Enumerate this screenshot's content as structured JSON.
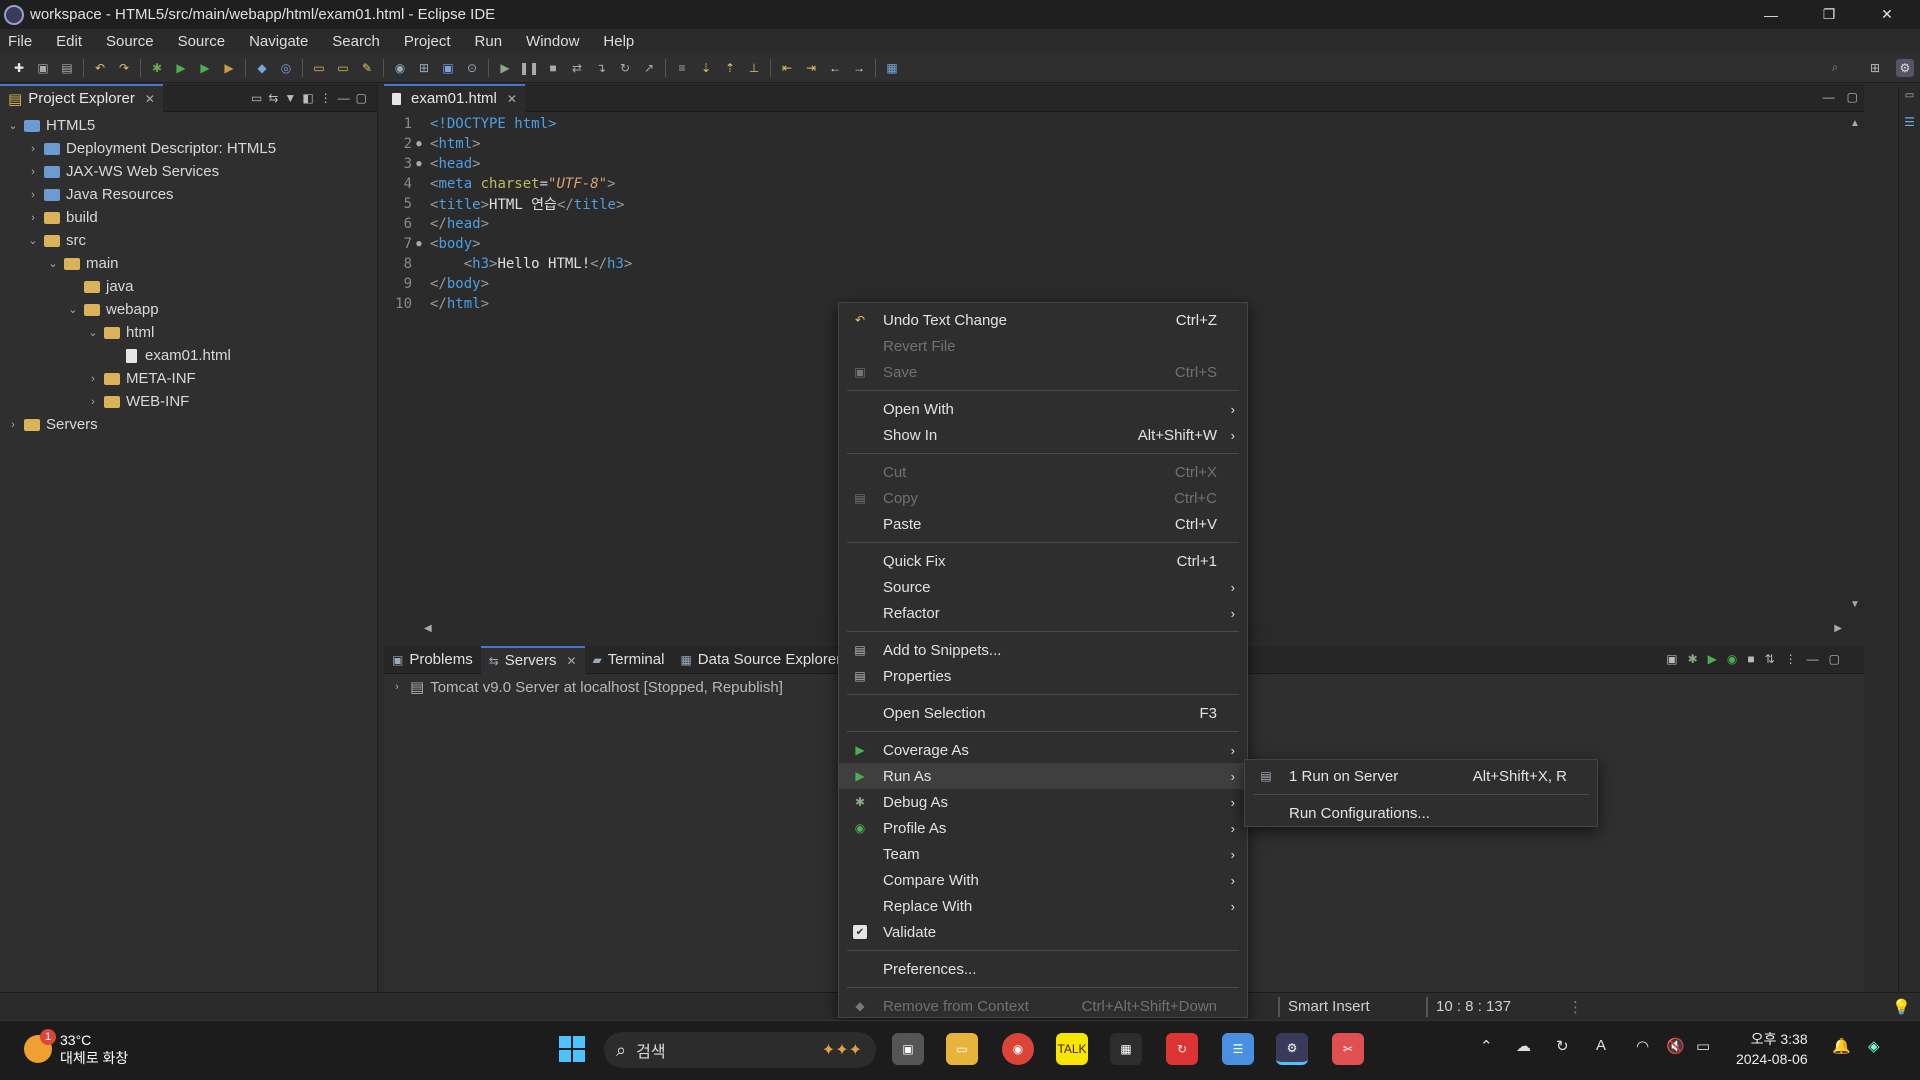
{
  "window": {
    "title": "workspace - HTML5/src/main/webapp/html/exam01.html - Eclipse IDE",
    "minimize": "—",
    "restore": "❐",
    "close": "✕"
  },
  "menubar": [
    "File",
    "Edit",
    "Source",
    "Source",
    "Navigate",
    "Search",
    "Project",
    "Run",
    "Window",
    "Help"
  ],
  "project_explorer": {
    "tab_label": "Project Explorer",
    "tree": [
      {
        "label": "HTML5",
        "depth": 0,
        "chev": "expanded",
        "icon": "proj"
      },
      {
        "label": "Deployment Descriptor: HTML5",
        "depth": 1,
        "chev": "collapsed",
        "icon": "proj"
      },
      {
        "label": "JAX-WS Web Services",
        "depth": 1,
        "chev": "collapsed",
        "icon": "proj"
      },
      {
        "label": "Java Resources",
        "depth": 1,
        "chev": "collapsed",
        "icon": "proj"
      },
      {
        "label": "build",
        "depth": 1,
        "chev": "collapsed",
        "icon": "folder"
      },
      {
        "label": "src",
        "depth": 1,
        "chev": "expanded",
        "icon": "folder"
      },
      {
        "label": "main",
        "depth": 2,
        "chev": "expanded",
        "icon": "folder"
      },
      {
        "label": "java",
        "depth": 3,
        "chev": "none",
        "icon": "folder"
      },
      {
        "label": "webapp",
        "depth": 3,
        "chev": "expanded",
        "icon": "folder"
      },
      {
        "label": "html",
        "depth": 4,
        "chev": "expanded",
        "icon": "folder"
      },
      {
        "label": "exam01.html",
        "depth": 5,
        "chev": "none",
        "icon": "file"
      },
      {
        "label": "META-INF",
        "depth": 4,
        "chev": "collapsed",
        "icon": "folder"
      },
      {
        "label": "WEB-INF",
        "depth": 4,
        "chev": "collapsed",
        "icon": "folder"
      },
      {
        "label": "Servers",
        "depth": 0,
        "chev": "collapsed",
        "icon": "folder"
      }
    ]
  },
  "editor": {
    "tab_label": "exam01.html",
    "lines": [
      {
        "n": "1",
        "fold": "",
        "html": "<span class='kw'>&lt;!DOCTYPE html&gt;</span>"
      },
      {
        "n": "2",
        "fold": "●",
        "html": "<span class='tagc'>&lt;</span><span class='kw'>html</span><span class='tagc'>&gt;</span>"
      },
      {
        "n": "3",
        "fold": "●",
        "html": "<span class='tagc'>&lt;</span><span class='kw'>head</span><span class='tagc'>&gt;</span>"
      },
      {
        "n": "4",
        "fold": "",
        "html": "<span class='tagc'>&lt;</span><span class='kw'>meta</span> <span class='attr'>charset</span>=<span class='str'>\"UTF-8\"</span><span class='tagc'>&gt;</span>"
      },
      {
        "n": "5",
        "fold": "",
        "html": "<span class='tagc'>&lt;</span><span class='kw'>title</span><span class='tagc'>&gt;</span><span class='txt'>HTML 연습</span><span class='tagc'>&lt;/</span><span class='kw'>title</span><span class='tagc'>&gt;</span>"
      },
      {
        "n": "6",
        "fold": "",
        "html": "<span class='tagc'>&lt;/</span><span class='kw'>head</span><span class='tagc'>&gt;</span>"
      },
      {
        "n": "7",
        "fold": "●",
        "html": "<span class='tagc'>&lt;</span><span class='kw'>body</span><span class='tagc'>&gt;</span>"
      },
      {
        "n": "8",
        "fold": "",
        "html": "    <span class='tagc'>&lt;</span><span class='kw'>h3</span><span class='tagc'>&gt;</span><span class='txt'>Hello HTML!</span><span class='tagc'>&lt;/</span><span class='kw'>h3</span><span class='tagc'>&gt;</span>"
      },
      {
        "n": "9",
        "fold": "",
        "html": "<span class='tagc'>&lt;/</span><span class='kw'>body</span><span class='tagc'>&gt;</span>"
      },
      {
        "n": "10",
        "fold": "",
        "html": "<span class='tagc'>&lt;/</span><span class='kw'>html</span><span class='tagc'>&gt;</span>"
      }
    ]
  },
  "bottom_panel": {
    "tabs": [
      {
        "label": "Problems",
        "active": false,
        "icon": "problems-icon"
      },
      {
        "label": "Servers",
        "active": true,
        "icon": "servers-icon"
      },
      {
        "label": "Terminal",
        "active": false,
        "icon": "terminal-icon"
      },
      {
        "label": "Data Source Explorer",
        "active": false,
        "icon": "data-source-icon"
      }
    ],
    "server_row": "Tomcat v9.0 Server at localhost  [Stopped, Republish]"
  },
  "statusbar": {
    "insert_mode": "Smart Insert",
    "position": "10 : 8 : 137"
  },
  "context_menu": [
    {
      "type": "item",
      "label": "Undo Text Change",
      "shortcut": "Ctrl+Z",
      "disabled": false,
      "icon": "undo-icon",
      "submenu": false
    },
    {
      "type": "item",
      "label": "Revert File",
      "shortcut": "",
      "disabled": true,
      "icon": "",
      "submenu": false
    },
    {
      "type": "item",
      "label": "Save",
      "shortcut": "Ctrl+S",
      "disabled": true,
      "icon": "save-icon",
      "submenu": false
    },
    {
      "type": "sep"
    },
    {
      "type": "item",
      "label": "Open With",
      "shortcut": "",
      "disabled": false,
      "icon": "",
      "submenu": true
    },
    {
      "type": "item",
      "label": "Show In",
      "shortcut": "Alt+Shift+W",
      "disabled": false,
      "icon": "",
      "submenu": true
    },
    {
      "type": "sep"
    },
    {
      "type": "item",
      "label": "Cut",
      "shortcut": "Ctrl+X",
      "disabled": true,
      "icon": "",
      "submenu": false
    },
    {
      "type": "item",
      "label": "Copy",
      "shortcut": "Ctrl+C",
      "disabled": true,
      "icon": "copy-icon",
      "submenu": false
    },
    {
      "type": "item",
      "label": "Paste",
      "shortcut": "Ctrl+V",
      "disabled": false,
      "icon": "",
      "submenu": false
    },
    {
      "type": "sep"
    },
    {
      "type": "item",
      "label": "Quick Fix",
      "shortcut": "Ctrl+1",
      "disabled": false,
      "icon": "",
      "submenu": false
    },
    {
      "type": "item",
      "label": "Source",
      "shortcut": "",
      "disabled": false,
      "icon": "",
      "submenu": true
    },
    {
      "type": "item",
      "label": "Refactor",
      "shortcut": "",
      "disabled": false,
      "icon": "",
      "submenu": true
    },
    {
      "type": "sep"
    },
    {
      "type": "item",
      "label": "Add to Snippets...",
      "shortcut": "",
      "disabled": false,
      "icon": "snippets-icon",
      "submenu": false
    },
    {
      "type": "item",
      "label": "Properties",
      "shortcut": "",
      "disabled": false,
      "icon": "properties-icon",
      "submenu": false
    },
    {
      "type": "sep"
    },
    {
      "type": "item",
      "label": "Open Selection",
      "shortcut": "F3",
      "disabled": false,
      "icon": "",
      "submenu": false
    },
    {
      "type": "sep"
    },
    {
      "type": "item",
      "label": "Coverage As",
      "shortcut": "",
      "disabled": false,
      "icon": "coverage-icon",
      "submenu": true
    },
    {
      "type": "item",
      "label": "Run As",
      "shortcut": "",
      "disabled": false,
      "icon": "run-icon",
      "submenu": true,
      "hover": true
    },
    {
      "type": "item",
      "label": "Debug As",
      "shortcut": "",
      "disabled": false,
      "icon": "debug-icon",
      "submenu": true
    },
    {
      "type": "item",
      "label": "Profile As",
      "shortcut": "",
      "disabled": false,
      "icon": "profile-icon",
      "submenu": true
    },
    {
      "type": "item",
      "label": "Team",
      "shortcut": "",
      "disabled": false,
      "icon": "",
      "submenu": true
    },
    {
      "type": "item",
      "label": "Compare With",
      "shortcut": "",
      "disabled": false,
      "icon": "",
      "submenu": true
    },
    {
      "type": "item",
      "label": "Replace With",
      "shortcut": "",
      "disabled": false,
      "icon": "",
      "submenu": true
    },
    {
      "type": "item",
      "label": "Validate",
      "shortcut": "",
      "disabled": false,
      "icon": "check-icon",
      "submenu": false
    },
    {
      "type": "sep"
    },
    {
      "type": "item",
      "label": "Preferences...",
      "shortcut": "",
      "disabled": false,
      "icon": "",
      "submenu": false
    },
    {
      "type": "sep"
    },
    {
      "type": "item",
      "label": "Remove from Context",
      "shortcut": "Ctrl+Alt+Shift+Down",
      "disabled": true,
      "icon": "remove-context-icon",
      "submenu": false
    }
  ],
  "submenu_run_as": [
    {
      "label": "1 Run on Server",
      "shortcut": "Alt+Shift+X, R",
      "icon": "server-icon"
    },
    {
      "label": "Run Configurations...",
      "shortcut": "",
      "icon": ""
    }
  ],
  "taskbar": {
    "weather_temp": "33°C",
    "weather_desc": "대체로 화창",
    "weather_badge": "1",
    "search_placeholder": "검색",
    "time": "오후 3:38",
    "date": "2024-08-06"
  }
}
